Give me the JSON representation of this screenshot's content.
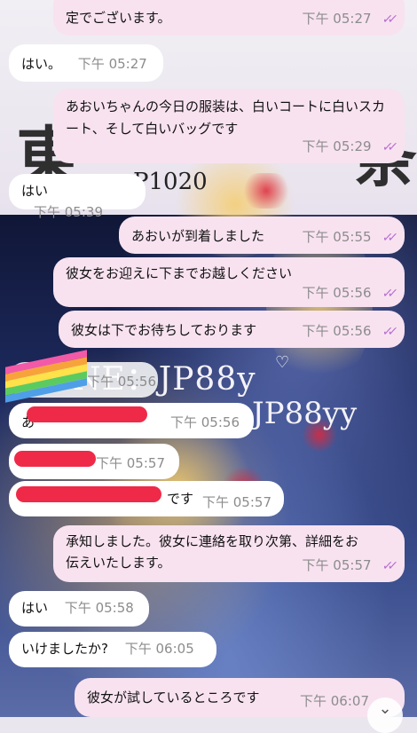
{
  "theme": {
    "incoming_bg": "#ffffff",
    "outgoing_bg": "#f8e2f0",
    "tick_color": "#b66fcf",
    "redaction_color": "#ee2a48"
  },
  "wallpaper": {
    "big_char_left": "東",
    "big_char_right": "条",
    "code": "P1020",
    "line1": "NE：JP88y",
    "line2": "JP88yy"
  },
  "messages": [
    {
      "dir": "out",
      "text": "定でございます。",
      "time": "下午 05:27",
      "read": true
    },
    {
      "dir": "in",
      "text": "はい。",
      "time": "下午 05:27"
    },
    {
      "dir": "out",
      "text": "あおいちゃんの今日の服装は、白いコートに白いスカート、そして白いバッグです",
      "time": "下午 05:29",
      "read": true
    },
    {
      "dir": "in",
      "text": "はい",
      "time": "下午 05:39"
    },
    {
      "dir": "out",
      "text": "あおいが到着しました",
      "time": "下午 05:55",
      "read": true
    },
    {
      "dir": "out",
      "text": "彼女をお迎えに下までお越しください",
      "time": "下午 05:56",
      "read": true
    },
    {
      "dir": "out",
      "text": "彼女は下でお待ちしております",
      "time": "下午 05:56",
      "read": true
    },
    {
      "dir": "in",
      "text": "",
      "time": "下午 05:56",
      "sticker": "rainbow-sticker"
    },
    {
      "dir": "in",
      "text": "あ",
      "time": "下午 05:56",
      "redacted": true
    },
    {
      "dir": "in",
      "text": "",
      "time": "下午 05:57",
      "redacted": true
    },
    {
      "dir": "in",
      "text": "です",
      "time": "下午 05:57",
      "redacted": true
    },
    {
      "dir": "out",
      "text": "承知しました。彼女に連絡を取り次第、詳細をお伝えいたします。",
      "time": "下午 05:57",
      "read": true
    },
    {
      "dir": "in",
      "text": "はい",
      "time": "下午 05:58"
    },
    {
      "dir": "in",
      "text": "いけましたか?",
      "time": "下午 06:05"
    },
    {
      "dir": "out",
      "text": "彼女が試しているところです",
      "time": "下午 06:07",
      "read": true
    }
  ],
  "scroll_button_icon": "chevron-down-icon"
}
